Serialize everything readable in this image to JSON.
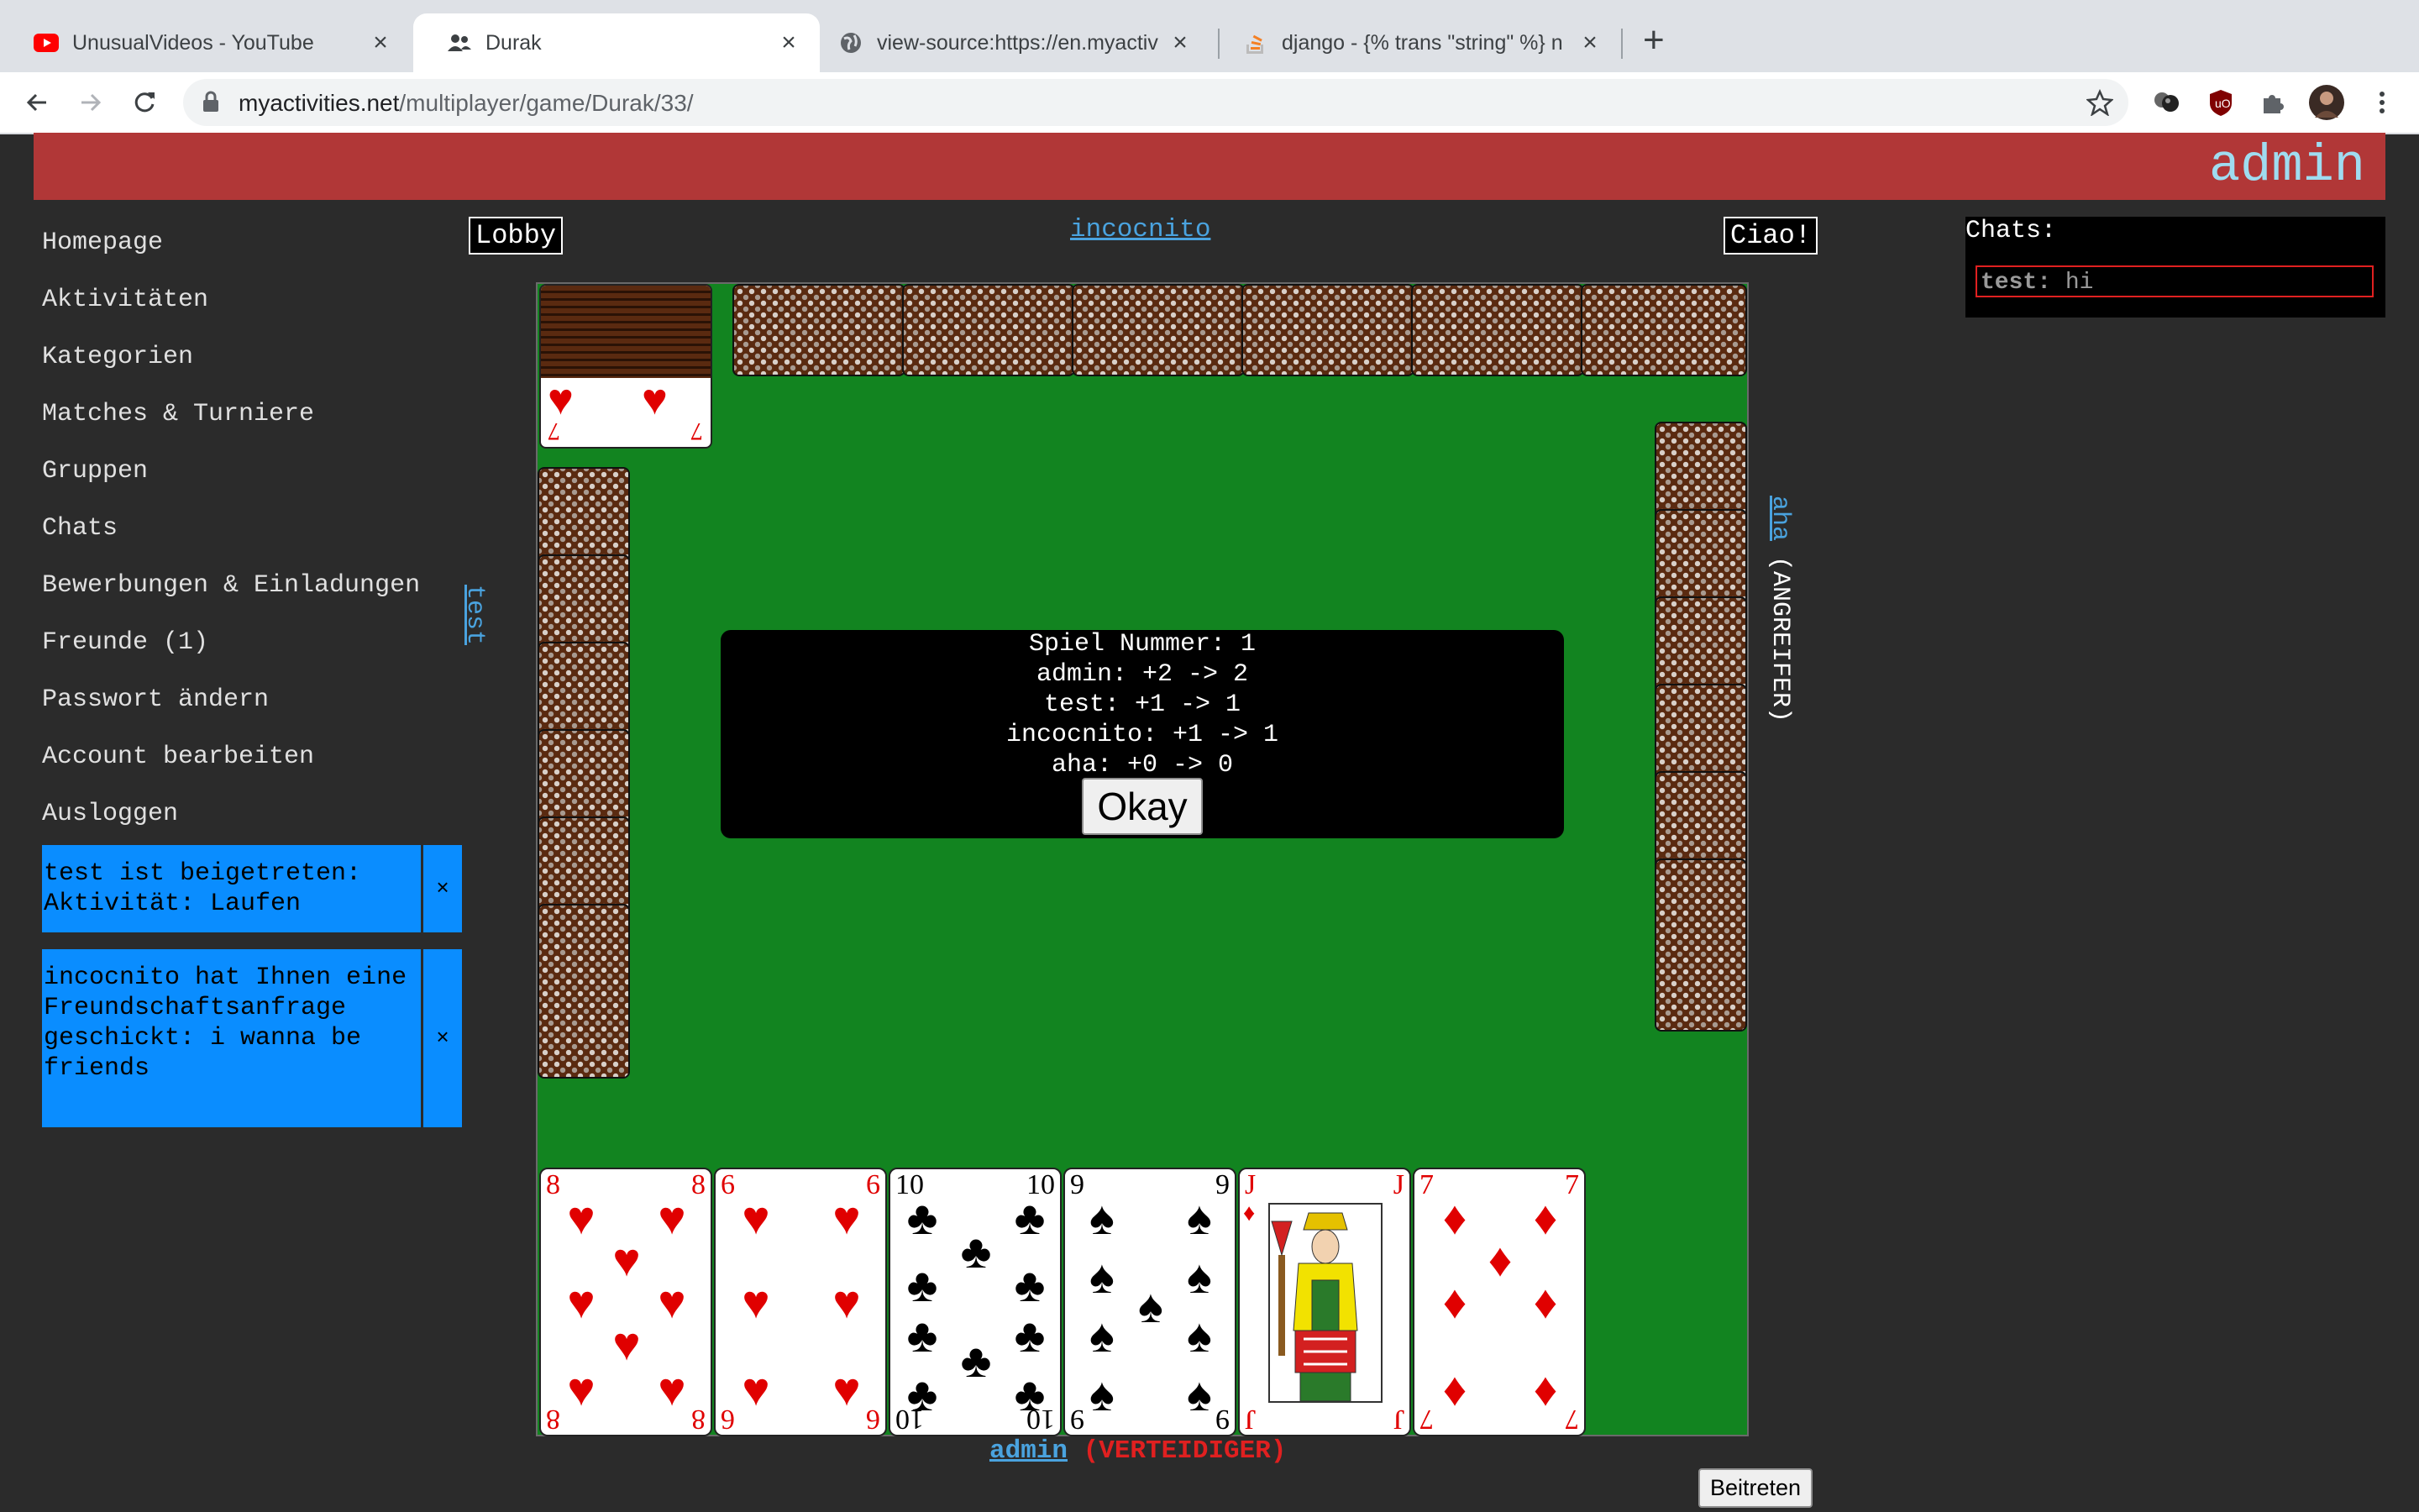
{
  "browser": {
    "tabs": [
      {
        "title": "UnusualVideos - YouTube",
        "icon": "youtube-icon"
      },
      {
        "title": "Durak",
        "icon": "people-icon",
        "active": true
      },
      {
        "title": "view-source:https://en.myactiv",
        "icon": "globe-icon"
      },
      {
        "title": "django - {% trans \"string\" %} n",
        "icon": "stackoverflow-icon"
      }
    ],
    "url_domain": "myactivities.net",
    "url_path": "/multiplayer/game/Durak/33/"
  },
  "header": {
    "username": "admin",
    "banner_color": "#b13737"
  },
  "sidebar": {
    "items": [
      "Homepage",
      "Aktivitäten",
      "Kategorien",
      "Matches & Turniere",
      "Gruppen",
      "Chats",
      "Bewerbungen & Einladungen",
      "Freunde (1)",
      "Passwort ändern",
      "Account bearbeiten",
      "Ausloggen"
    ],
    "notifications": [
      {
        "text": "test ist beigetreten: Aktivität: Laufen",
        "close": "×"
      },
      {
        "text": "incocnito hat Ihnen eine Freundschaftsanfrage geschickt: i wanna be friends",
        "close": "×"
      }
    ]
  },
  "game": {
    "lobby_label": "Lobby",
    "ciao_label": "Ciao!",
    "top_player": "incocnito",
    "left_player": "test",
    "right_player": "aha",
    "right_role": "(ANGREIFER)",
    "bottom_player": "admin",
    "bottom_role": "(VERTEIDIGER)",
    "join_label": "Beitreten",
    "table_color": "#128420",
    "trump_card": {
      "rank": "7",
      "suit": "hearts"
    },
    "hand": [
      {
        "rank": "8",
        "suit": "hearts"
      },
      {
        "rank": "6",
        "suit": "hearts"
      },
      {
        "rank": "10",
        "suit": "clubs"
      },
      {
        "rank": "9",
        "suit": "spades"
      },
      {
        "rank": "J",
        "suit": "diamonds"
      },
      {
        "rank": "7",
        "suit": "diamonds"
      }
    ],
    "result_dialog": {
      "lines": [
        "Spiel Nummer: 1",
        "admin: +2 -> 2",
        "test: +1 -> 1",
        "incocnito: +1 -> 1",
        "aha: +0 -> 0"
      ],
      "button": "Okay"
    }
  },
  "chats": {
    "title": "Chats:",
    "items": [
      {
        "user": "test:",
        "message": "hi"
      }
    ]
  }
}
